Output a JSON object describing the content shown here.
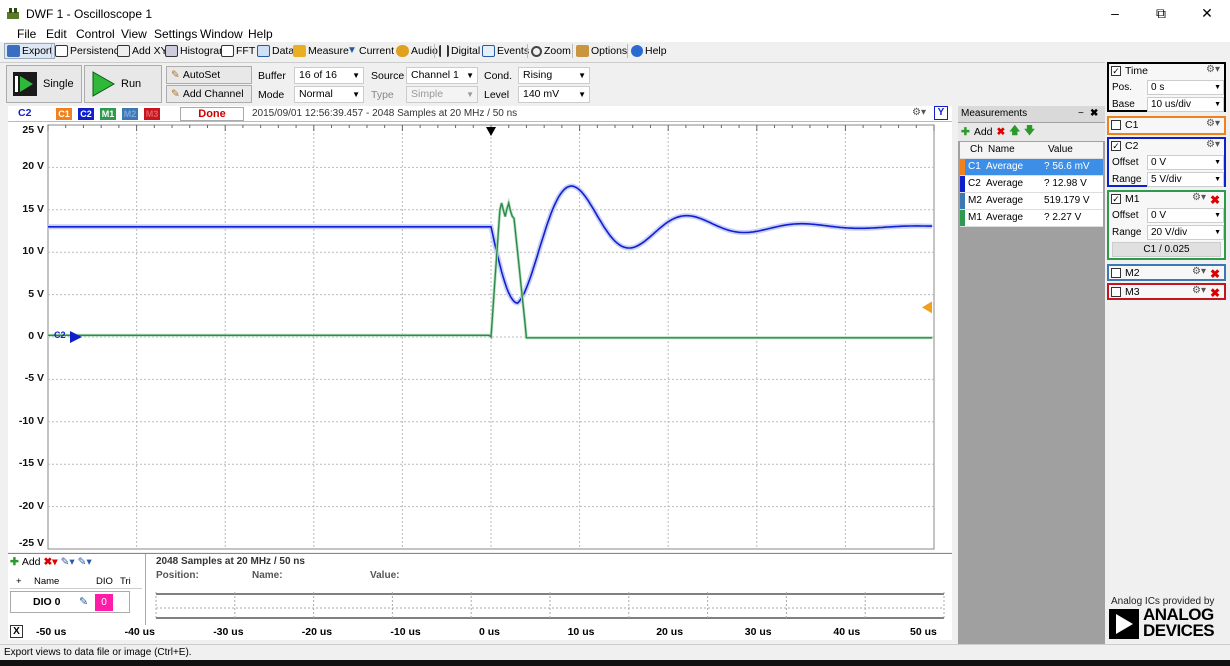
{
  "window": {
    "title": "DWF 1 - Oscilloscope 1"
  },
  "menu": [
    "File",
    "Edit",
    "Control",
    "View",
    "Settings",
    "Window",
    "Help"
  ],
  "toolbar": [
    "Export",
    "Persistence",
    "Add XY",
    "Histogram",
    "FFT",
    "Data",
    "Measure",
    "Current",
    "Audio",
    "Digital",
    "Events",
    "Zoom",
    "Options",
    "Help"
  ],
  "controls": {
    "single": "Single",
    "run": "Run",
    "autoset": "AutoSet",
    "add_channel": "Add Channel",
    "buffer_label": "Buffer",
    "buffer_value": "16 of 16",
    "mode_label": "Mode",
    "mode_value": "Normal",
    "source_label": "Source",
    "source_value": "Channel 1",
    "type_label": "Type",
    "type_value": "Simple",
    "cond_label": "Cond.",
    "cond_value": "Rising",
    "level_label": "Level",
    "level_value": "140 mV"
  },
  "scope": {
    "active_channel": "C2",
    "channel_tabs": [
      {
        "label": "C1",
        "color": "#f0821e"
      },
      {
        "label": "C2",
        "color": "#1020c8"
      },
      {
        "label": "M1",
        "color": "#2e9a4e"
      },
      {
        "label": "M2",
        "color": "#3c78b4"
      },
      {
        "label": "M3",
        "color": "#c8141e"
      }
    ],
    "status": "Done",
    "info": "2015/09/01 12:56:39.457 - 2048 Samples at 20 MHz / 50 ns",
    "y_labels": [
      "25 V",
      "20 V",
      "15 V",
      "10 V",
      "5 V",
      "0 V",
      "-5 V",
      "-10 V",
      "-15 V",
      "-20 V",
      "-25 V"
    ],
    "x_labels": [
      "-50 us",
      "-40 us",
      "-30 us",
      "-20 us",
      "-10 us",
      "0 us",
      "10 us",
      "20 us",
      "30 us",
      "40 us",
      "50 us"
    ],
    "marker_label": "C2",
    "y_button": "Y"
  },
  "logic": {
    "add": "Add",
    "col_name": "Name",
    "col_dio": "DIO",
    "col_tr": "Tri",
    "row_name": "DIO 0",
    "row_value": "0",
    "info": "2048 Samples at 20 MHz / 50 ns",
    "position": "Position:",
    "name": "Name:",
    "value": "Value:",
    "x_button": "X"
  },
  "measurements": {
    "title": "Measurements",
    "add": "Add",
    "headers": [
      "Ch",
      "Name",
      "Value"
    ],
    "rows": [
      {
        "ch": "C1",
        "name": "Average",
        "value": "? 56.6 mV",
        "color": "#f0821e"
      },
      {
        "ch": "C2",
        "name": "Average",
        "value": "? 12.98 V",
        "color": "#1020c8"
      },
      {
        "ch": "M2",
        "name": "Average",
        "value": "519.179 V",
        "color": "#3c78b4"
      },
      {
        "ch": "M1",
        "name": "Average",
        "value": "? 2.27 V",
        "color": "#2e9a4e"
      }
    ]
  },
  "right_panel": {
    "time": {
      "title": "Time",
      "pos_label": "Pos.",
      "pos_value": "0 s",
      "base_label": "Base",
      "base_value": "10 us/div"
    },
    "c1": {
      "title": "C1"
    },
    "c2": {
      "title": "C2",
      "offset_label": "Offset",
      "offset_value": "0 V",
      "range_label": "Range",
      "range_value": "5 V/div"
    },
    "m1": {
      "title": "M1",
      "offset_label": "Offset",
      "offset_value": "0 V",
      "range_label": "Range",
      "range_value": "20 V/div",
      "formula": "C1 / 0.025"
    },
    "m2": {
      "title": "M2"
    },
    "m3": {
      "title": "M3"
    },
    "brand_caption": "Analog ICs provided by",
    "brand_line1": "ANALOG",
    "brand_line2": "DEVICES"
  },
  "status_bar": "Export views to data file or image (Ctrl+E)."
}
